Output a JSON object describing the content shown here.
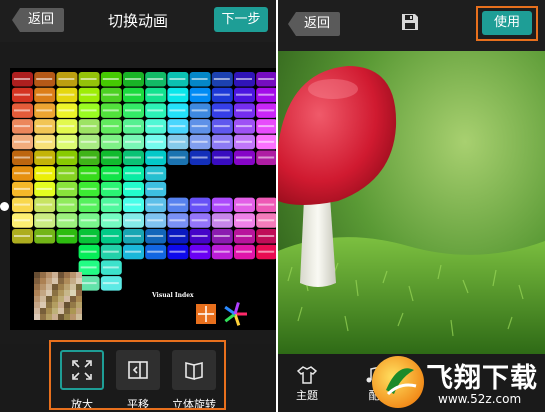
{
  "left_screen": {
    "back_label": "返回",
    "title": "切换动画",
    "next_label": "下一步",
    "image_caption": "Visual Index",
    "animations": [
      {
        "label": "放大",
        "icon": "zoom-expand-icon",
        "selected": true
      },
      {
        "label": "平移",
        "icon": "slide-icon",
        "selected": false
      },
      {
        "label": "立体旋转",
        "icon": "3d-rotate-icon",
        "selected": false
      }
    ]
  },
  "right_screen": {
    "back_label": "返回",
    "save_icon": "save-icon",
    "use_label": "使用",
    "toolbar": [
      {
        "label": "主题",
        "icon": "shirt-icon"
      },
      {
        "label": "配",
        "icon": "music-icon"
      }
    ],
    "watermark": {
      "brand": "飞翔下载",
      "url": "www.52z.com"
    }
  },
  "colors": {
    "accent": "#1e9e96",
    "highlight": "#e8701d",
    "bar": "#1b1b1b"
  }
}
